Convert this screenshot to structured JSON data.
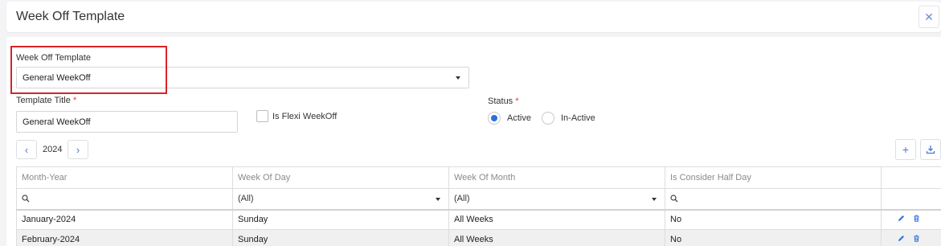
{
  "header": {
    "title": "Week Off Template",
    "close_icon": "close-icon"
  },
  "form": {
    "template_select": {
      "label": "Week Off Template",
      "value": "General WeekOff"
    },
    "template_title": {
      "label": "Template Title",
      "required_mark": "*",
      "value": "General WeekOff"
    },
    "flexi": {
      "label": "Is Flexi WeekOff",
      "checked": false
    },
    "status": {
      "label": "Status",
      "required_mark": "*",
      "options": [
        {
          "label": "Active",
          "selected": true
        },
        {
          "label": "In-Active",
          "selected": false
        }
      ]
    }
  },
  "year_nav": {
    "prev_icon": "chevron-left-icon",
    "year": "2024",
    "next_icon": "chevron-right-icon"
  },
  "toolbar": {
    "add_icon": "plus-icon",
    "download_icon": "download-icon"
  },
  "table": {
    "columns": [
      "Month-Year",
      "Week Of Day",
      "Week Of Month",
      "Is Consider Half Day",
      ""
    ],
    "filters": {
      "week_of_day": "(All)",
      "week_of_month": "(All)"
    },
    "rows": [
      {
        "month_year": "January-2024",
        "week_of_day": "Sunday",
        "week_of_month": "All Weeks",
        "half_day": "No"
      },
      {
        "month_year": "February-2024",
        "week_of_day": "Sunday",
        "week_of_month": "All Weeks",
        "half_day": "No"
      }
    ]
  },
  "colors": {
    "accent": "#2f6fdb",
    "highlight": "#d9232a",
    "required": "#e53935"
  }
}
